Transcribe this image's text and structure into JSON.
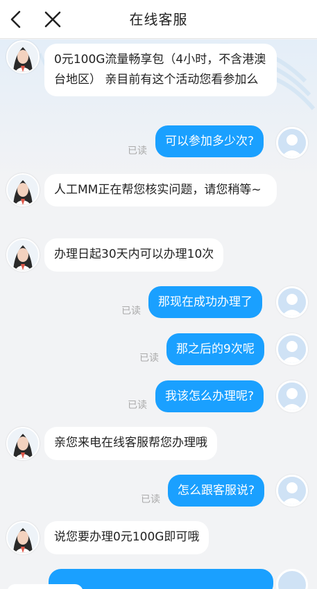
{
  "header": {
    "title": "在线客服",
    "back_icon": "chevron-left-icon",
    "close_icon": "close-icon"
  },
  "theme": {
    "header_bg": "#ffffff",
    "chat_bg": "#f2f3f5",
    "outgoing_bubble": "#1aa0ff",
    "incoming_bubble": "#ffffff",
    "read_text": "#aaaaaa"
  },
  "messages": [
    {
      "from": "agent",
      "text": "0元100G流量畅享包（4小时，不含港澳台地区） 亲目前有这个活动您看参加么"
    },
    {
      "from": "user",
      "text": "可以参加多少次?",
      "status": "已读"
    },
    {
      "from": "agent",
      "text": "人工MM正在帮您核实问题，请您稍等~"
    },
    {
      "from": "agent",
      "text": "办理日起30天内可以办理10次"
    },
    {
      "from": "user",
      "text": "那现在成功办理了",
      "status": "已读"
    },
    {
      "from": "user",
      "text": "那之后的9次呢",
      "status": "已读"
    },
    {
      "from": "user",
      "text": "我该怎么办理呢?",
      "status": "已读"
    },
    {
      "from": "agent",
      "text": "亲您来电在线客服帮您办理哦"
    },
    {
      "from": "user",
      "text": "怎么跟客服说?",
      "status": "已读"
    },
    {
      "from": "agent",
      "text": "说您要办理0元100G即可哦"
    }
  ]
}
